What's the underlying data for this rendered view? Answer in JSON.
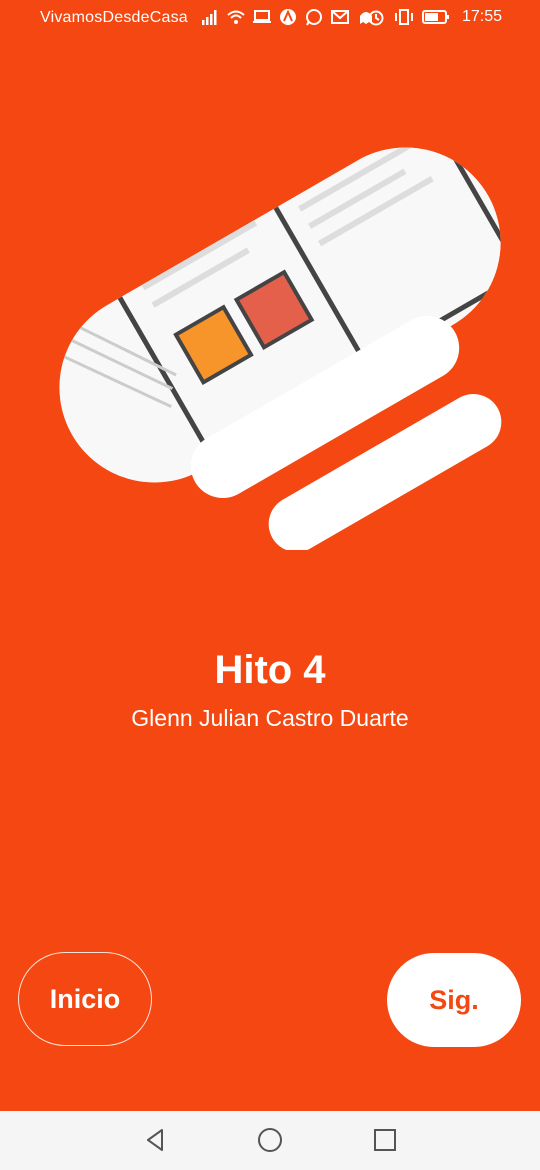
{
  "status_bar": {
    "carrier": "VivamosDesdeCasa",
    "time": "17:55",
    "icons_left": [
      "signal-icon",
      "wifi-icon",
      "laptop-icon",
      "app-icon",
      "whatsapp-icon",
      "mail-icon",
      "ghost-icon"
    ],
    "icons_right": [
      "alarm-icon",
      "vibrate-icon",
      "battery-icon"
    ]
  },
  "slide": {
    "title": "Hito 4",
    "author": "Glenn Julian Castro Duarte",
    "illustration": "newspaper-illustration"
  },
  "buttons": {
    "start_label": "Inicio",
    "next_label": "Sig."
  },
  "nav_bar": {
    "back": "back-icon",
    "home": "home-icon",
    "recents": "recents-icon"
  },
  "colors": {
    "background": "#f44711",
    "white": "#ffffff",
    "nav_background": "#f5f5f5"
  }
}
